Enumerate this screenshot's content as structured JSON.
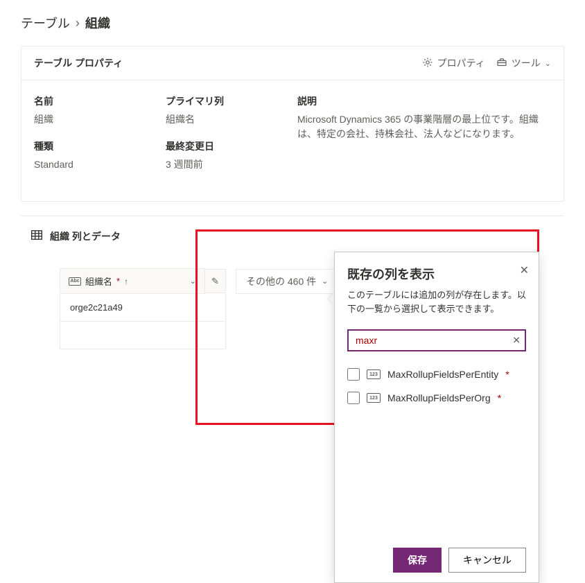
{
  "breadcrumb": {
    "parent": "テーブル",
    "separator": "›",
    "current": "組織"
  },
  "props_card": {
    "title": "テーブル プロパティ",
    "actions": {
      "properties": "プロパティ",
      "tools": "ツール"
    },
    "name_label": "名前",
    "name_value": "組織",
    "type_label": "種類",
    "type_value": "Standard",
    "primary_label": "プライマリ列",
    "primary_value": "組織名",
    "modified_label": "最終変更日",
    "modified_value": "3 週間前",
    "desc_label": "説明",
    "desc_value": "Microsoft Dynamics 365 の事業階層の最上位です。組織は、特定の会社、持株会社、法人などになります。"
  },
  "data_section": {
    "title": "組織 列とデータ",
    "column": {
      "type_icon": "Abc",
      "name": "組織名",
      "required_mark": "*",
      "sort_arrow": "↑"
    },
    "other_columns": "その他の 460 件",
    "rows": [
      "orge2c21a49"
    ],
    "edit_icon_label": "✎"
  },
  "panel": {
    "title": "既存の列を表示",
    "desc": "このテーブルには追加の列が存在します。以下の一覧から選択して表示できます。",
    "search_value": "maxr",
    "clear_icon": "✕",
    "items": [
      {
        "type_icon": "123",
        "label": "MaxRollupFieldsPerEntity",
        "required": true
      },
      {
        "type_icon": "123",
        "label": "MaxRollupFieldsPerOrg",
        "required": true
      }
    ],
    "save": "保存",
    "cancel": "キャンセル",
    "close_icon": "✕"
  }
}
